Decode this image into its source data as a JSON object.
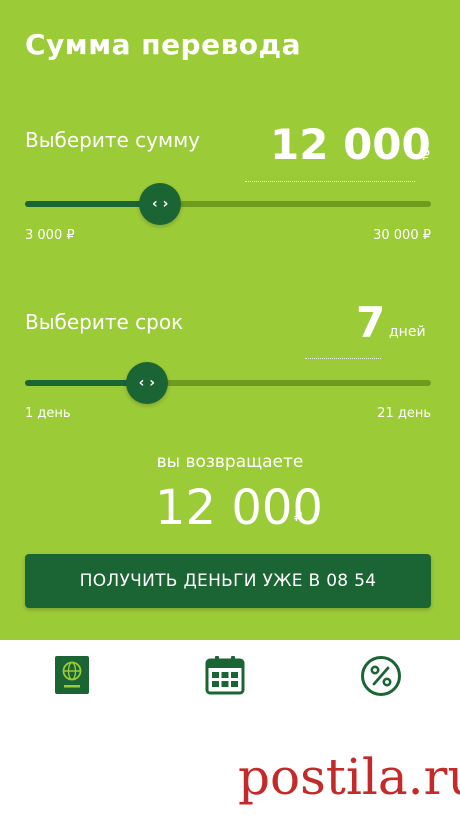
{
  "title": "Сумма перевода",
  "amount": {
    "label": "Выберите сумму",
    "value": "12 000",
    "unit": "₽",
    "min_label": "3 000 ₽",
    "max_label": "30 000 ₽",
    "thumb_glyph": "‹ ›",
    "fill_fraction": 0.333
  },
  "term": {
    "label": "Выберите срок",
    "value": "7",
    "unit": "дней",
    "min_label": "1 день",
    "max_label": "21 день",
    "thumb_glyph": "‹ ›",
    "fill_fraction": 0.3
  },
  "return": {
    "label": "вы возвращаете",
    "value": "12 000",
    "unit": "₽"
  },
  "cta_label": "ПОЛУЧИТЬ ДЕНЬГИ УЖЕ В 08 54",
  "nav": {
    "icons": [
      "passport-icon",
      "calendar-icon",
      "percent-icon"
    ]
  },
  "watermark": "postila.ru",
  "colors": {
    "background": "#9ccb38",
    "dark_green": "#1b6434",
    "track": "#6f9c1f",
    "watermark": "#c52a2a"
  }
}
